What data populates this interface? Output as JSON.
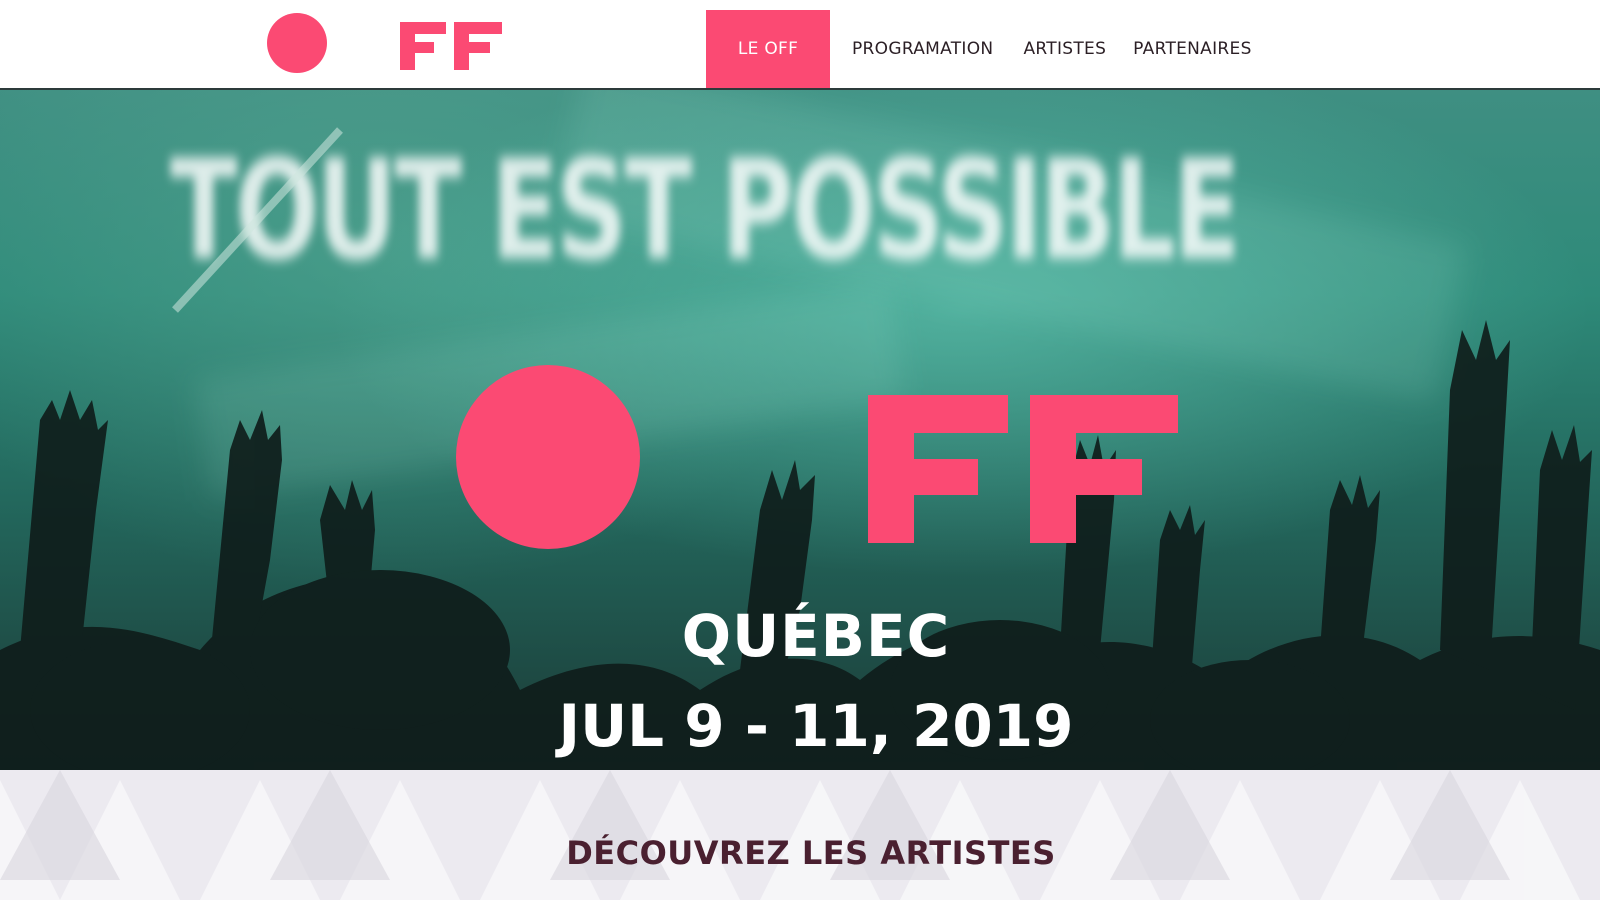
{
  "header": {
    "logo": {
      "name": "festival-logo",
      "letters": "FF"
    },
    "nav": [
      {
        "label": "LE OFF",
        "active": true
      },
      {
        "label": "PROGRAMATION",
        "active": false
      },
      {
        "label": "ARTISTES",
        "active": false
      },
      {
        "label": "PARTENAIRES",
        "active": false
      }
    ]
  },
  "hero": {
    "background_text": "TOUT EST POSSIBLE",
    "logo_letters": "FF",
    "city": "QUÉBEC",
    "dates": "JUL 9 - 11, 2019"
  },
  "section": {
    "title": "DÉCOUVREZ LES ARTISTES"
  },
  "colors": {
    "brand": "#fb4a73",
    "nav_text": "#2b1f25",
    "section_title": "#4a2030",
    "hero_teal": "#2e8a79"
  }
}
